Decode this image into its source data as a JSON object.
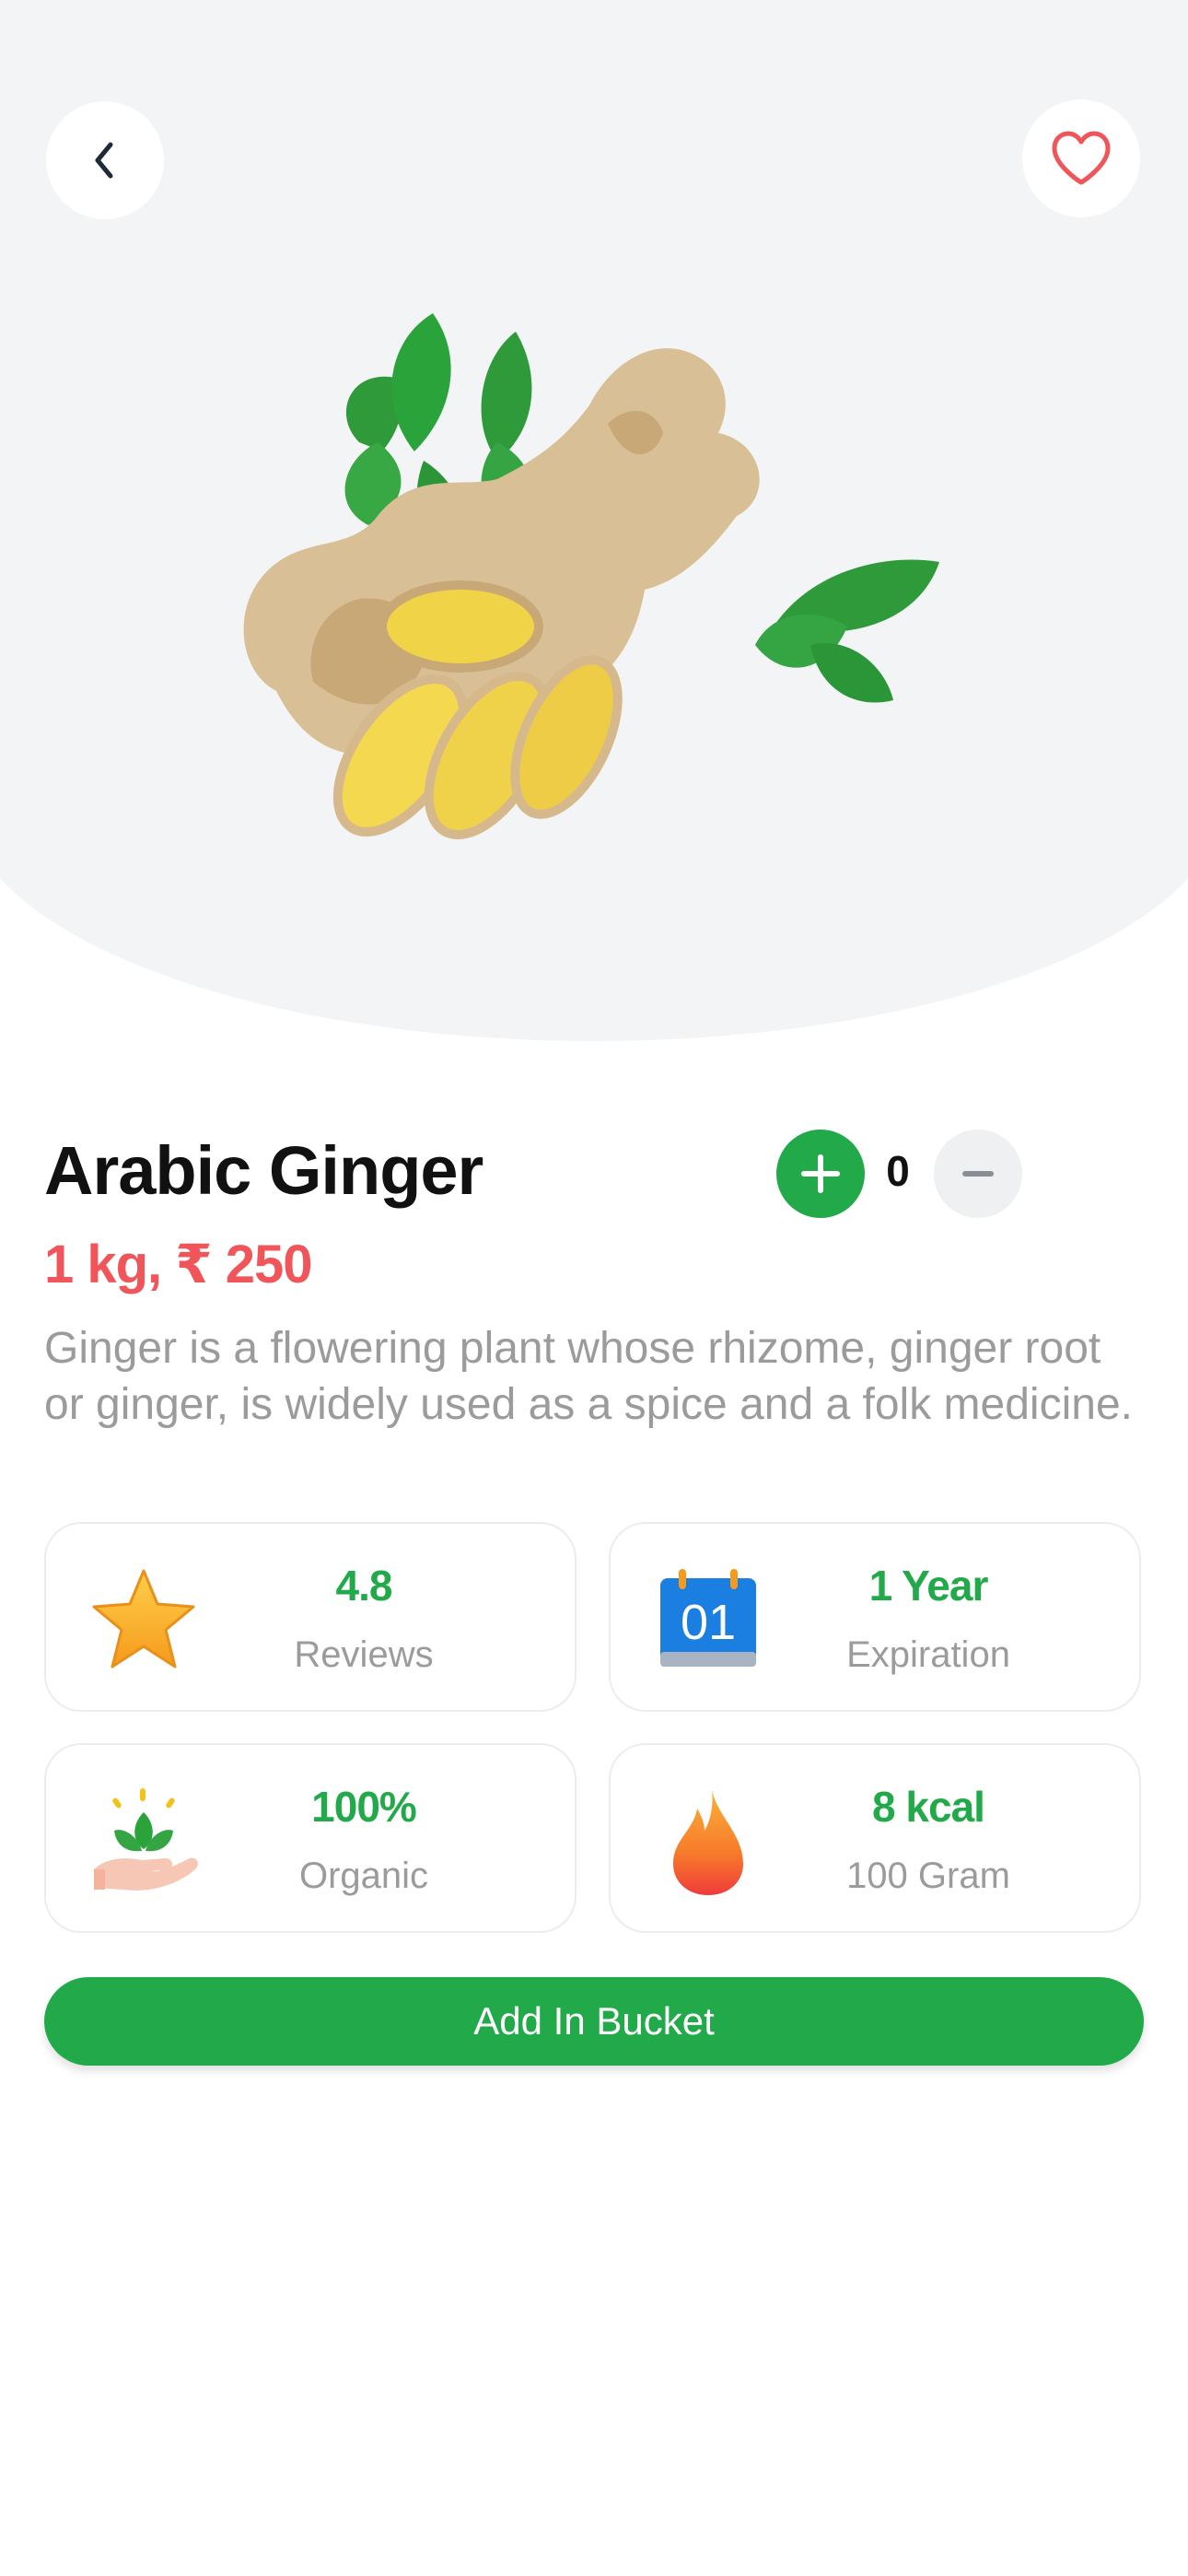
{
  "product": {
    "name": "Arabic Ginger",
    "price": "1 kg, ₹ 250",
    "description": "Ginger is a flowering plant whose rhizome, ginger root or ginger, is widely used as a spice and a folk medicine.",
    "image": "ginger-with-mint-leaves"
  },
  "quantity": {
    "value": "0"
  },
  "icons": {
    "back": "chevron-left-icon",
    "favorite": "heart-outline-icon",
    "plus": "plus-icon",
    "minus": "minus-icon"
  },
  "stats": [
    {
      "value": "4.8",
      "label": "Reviews",
      "icon": "star-icon"
    },
    {
      "value": "1 Year",
      "label": "Expiration",
      "icon": "calendar-icon",
      "icon_text": "01"
    },
    {
      "value": "100%",
      "label": "Organic",
      "icon": "plant-hand-icon"
    },
    {
      "value": "8 kcal",
      "label": "100 Gram",
      "icon": "flame-icon"
    }
  ],
  "cta": {
    "label": "Add In Bucket"
  },
  "colors": {
    "accent_green": "#22aa4a",
    "price_red": "#f0555a",
    "heart_red": "#f0555a",
    "hero_background": "#f3f4f6",
    "muted_text": "#9b9b9b"
  }
}
